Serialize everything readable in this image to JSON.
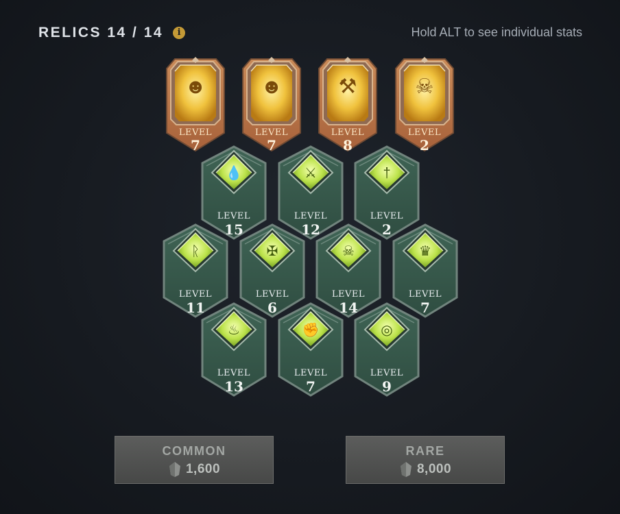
{
  "header": {
    "title": "RELICS 14 / 14",
    "info_icon": "info-icon",
    "hint": "Hold ALT to see individual stats"
  },
  "colors": {
    "gold": "#e9b93f",
    "gold_frame": "#c98a4d",
    "green": "#b8e24a",
    "green_frame": "#3c5a4c",
    "button_bg": "#555654",
    "accent_info": "#c49a36"
  },
  "relics": [
    {
      "rarity": "rare",
      "label": "LEVEL",
      "level": "7",
      "icon": "cheering-face-icon"
    },
    {
      "rarity": "rare",
      "label": "LEVEL",
      "level": "7",
      "icon": "cheering-face-icon"
    },
    {
      "rarity": "rare",
      "label": "LEVEL",
      "level": "8",
      "icon": "crossed-axes-icon"
    },
    {
      "rarity": "rare",
      "label": "LEVEL",
      "level": "2",
      "icon": "skull-scythe-icon"
    },
    {
      "rarity": "common",
      "label": "LEVEL",
      "level": "15",
      "icon": "droplet-icon"
    },
    {
      "rarity": "common",
      "label": "LEVEL",
      "level": "12",
      "icon": "crossed-swords-icon"
    },
    {
      "rarity": "common",
      "label": "LEVEL",
      "level": "2",
      "icon": "dagger-icon"
    },
    {
      "rarity": "common",
      "label": "LEVEL",
      "level": "11",
      "icon": "runes-icon"
    },
    {
      "rarity": "common",
      "label": "LEVEL",
      "level": "6",
      "icon": "bones-icon"
    },
    {
      "rarity": "common",
      "label": "LEVEL",
      "level": "14",
      "icon": "skull-icon"
    },
    {
      "rarity": "common",
      "label": "LEVEL",
      "level": "7",
      "icon": "crown-icon"
    },
    {
      "rarity": "common",
      "label": "LEVEL",
      "level": "13",
      "icon": "flame-icon"
    },
    {
      "rarity": "common",
      "label": "LEVEL",
      "level": "7",
      "icon": "fist-icon"
    },
    {
      "rarity": "common",
      "label": "LEVEL",
      "level": "9",
      "icon": "coins-icon"
    }
  ],
  "buttons": {
    "common": {
      "title": "COMMON",
      "cost": "1,600",
      "icon": "shard-icon"
    },
    "rare": {
      "title": "RARE",
      "cost": "8,000",
      "icon": "shard-icon"
    }
  }
}
